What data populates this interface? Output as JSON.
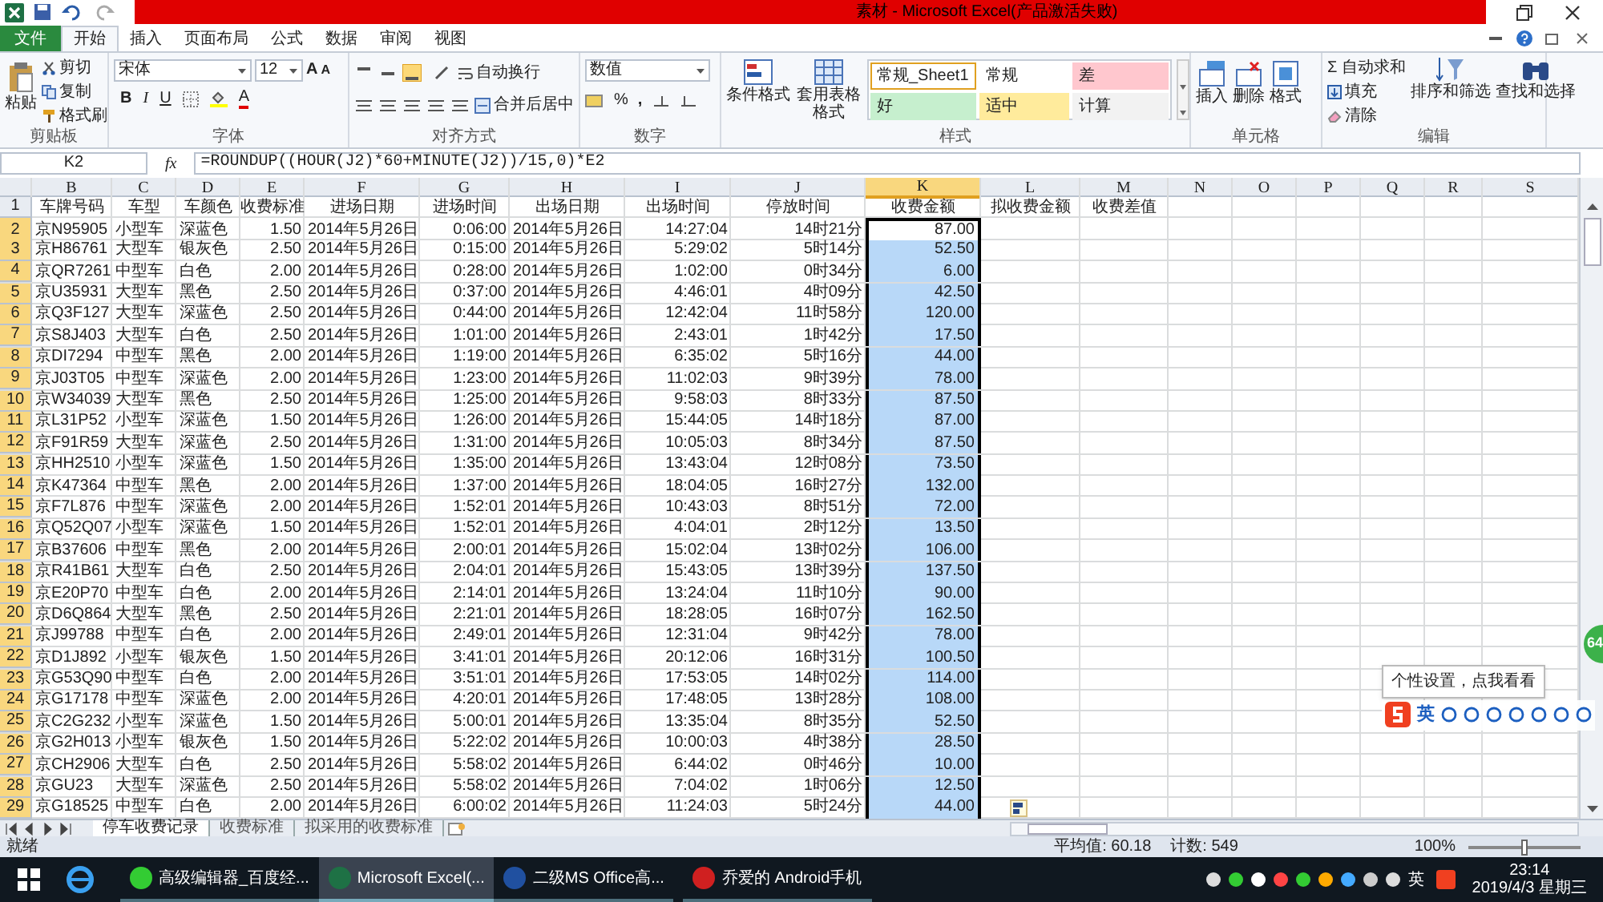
{
  "window": {
    "title": "素材 - Microsoft Excel(产品激活失败)"
  },
  "tabs": [
    {
      "label": "文件",
      "kind": "file",
      "selected": false
    },
    {
      "label": "开始",
      "kind": "tab",
      "selected": true
    },
    {
      "label": "插入",
      "kind": "tab",
      "selected": false
    },
    {
      "label": "页面布局",
      "kind": "tab",
      "selected": false
    },
    {
      "label": "公式",
      "kind": "tab",
      "selected": false
    },
    {
      "label": "数据",
      "kind": "tab",
      "selected": false
    },
    {
      "label": "审阅",
      "kind": "tab",
      "selected": false
    },
    {
      "label": "视图",
      "kind": "tab",
      "selected": false
    }
  ],
  "ribbon": {
    "clipboard": {
      "label": "剪贴板",
      "paste": "粘贴",
      "cut": "剪切",
      "copy": "复制",
      "format_painter": "格式刷"
    },
    "font": {
      "label": "字体",
      "font_name": "宋体",
      "font_size": "12",
      "grow": "A",
      "shrink": "A",
      "bold": "B",
      "italic": "I",
      "underline": "U",
      "color_letter": "A"
    },
    "alignment": {
      "label": "对齐方式",
      "wrap": "自动换行",
      "merge": "合并后居中"
    },
    "number": {
      "label": "数字",
      "format": "数值",
      "percent": "%",
      "comma": ","
    },
    "styles": {
      "label": "样式",
      "conditional": "条件格式",
      "table_format": "套用表格格式",
      "cell_styles": [
        {
          "label": "常规_Sheet1",
          "color": "#ffffff",
          "selected": true
        },
        {
          "label": "常规",
          "color": "#ffffff",
          "selected": false
        },
        {
          "label": "差",
          "color": "#ffc7ce",
          "selected": false
        },
        {
          "label": "好",
          "color": "#c6efce",
          "selected": false
        },
        {
          "label": "适中",
          "color": "#ffeb9c",
          "selected": false
        },
        {
          "label": "计算",
          "color": "#f2f2f2",
          "selected": false
        }
      ]
    },
    "cells": {
      "label": "单元格",
      "insert": "插入",
      "delete": "删除",
      "format": "格式"
    },
    "editing": {
      "label": "编辑",
      "sigma": "Σ",
      "autosum": "自动求和",
      "fill": "填充",
      "clear": "清除",
      "sort": "排序和筛选",
      "find": "查找和选择"
    }
  },
  "formula_bar": {
    "name_box": "K2",
    "fx": "fx",
    "formula": "=ROUNDUP((HOUR(J2)*60+MINUTE(J2))/15,0)*E2"
  },
  "sheet": {
    "columns": [
      {
        "label": "B",
        "selected": false
      },
      {
        "label": "C",
        "selected": false
      },
      {
        "label": "D",
        "selected": false
      },
      {
        "label": "E",
        "selected": false
      },
      {
        "label": "F",
        "selected": false
      },
      {
        "label": "G",
        "selected": false
      },
      {
        "label": "H",
        "selected": false
      },
      {
        "label": "I",
        "selected": false
      },
      {
        "label": "J",
        "selected": false
      },
      {
        "label": "K",
        "selected": true
      },
      {
        "label": "L",
        "selected": false
      },
      {
        "label": "M",
        "selected": false
      },
      {
        "label": "N",
        "selected": false
      },
      {
        "label": "O",
        "selected": false
      },
      {
        "label": "P",
        "selected": false
      },
      {
        "label": "Q",
        "selected": false
      },
      {
        "label": "R",
        "selected": false
      },
      {
        "label": "S",
        "selected": false
      }
    ],
    "header_row": {
      "row_number": "1",
      "cells": [
        "车牌号码",
        "车型",
        "车颜色",
        "收费标准",
        "进场日期",
        "进场时间",
        "出场日期",
        "出场时间",
        "停放时间",
        "收费金额",
        "拟收费金额",
        "收费差值"
      ]
    },
    "rows": [
      {
        "row_number": "2",
        "selected": true,
        "active": true,
        "cells": [
          "京N95905",
          "小型车",
          "深蓝色",
          "1.50",
          "2014年5月26日",
          "0:06:00",
          "2014年5月26日",
          "14:27:04",
          "14时21分",
          "87.00"
        ]
      },
      {
        "row_number": "3",
        "selected": true,
        "active": false,
        "cells": [
          "京H86761",
          "大型车",
          "银灰色",
          "2.50",
          "2014年5月26日",
          "0:15:00",
          "2014年5月26日",
          "5:29:02",
          "5时14分",
          "52.50"
        ]
      },
      {
        "row_number": "4",
        "selected": true,
        "active": false,
        "cells": [
          "京QR7261",
          "中型车",
          "白色",
          "2.00",
          "2014年5月26日",
          "0:28:00",
          "2014年5月26日",
          "1:02:00",
          "0时34分",
          "6.00"
        ]
      },
      {
        "row_number": "5",
        "selected": true,
        "active": false,
        "cells": [
          "京U35931",
          "大型车",
          "黑色",
          "2.50",
          "2014年5月26日",
          "0:37:00",
          "2014年5月26日",
          "4:46:01",
          "4时09分",
          "42.50"
        ]
      },
      {
        "row_number": "6",
        "selected": true,
        "active": false,
        "cells": [
          "京Q3F127",
          "大型车",
          "深蓝色",
          "2.50",
          "2014年5月26日",
          "0:44:00",
          "2014年5月26日",
          "12:42:04",
          "11时58分",
          "120.00"
        ]
      },
      {
        "row_number": "7",
        "selected": true,
        "active": false,
        "cells": [
          "京S8J403",
          "大型车",
          "白色",
          "2.50",
          "2014年5月26日",
          "1:01:00",
          "2014年5月26日",
          "2:43:01",
          "1时42分",
          "17.50"
        ]
      },
      {
        "row_number": "8",
        "selected": true,
        "active": false,
        "cells": [
          "京DI7294",
          "中型车",
          "黑色",
          "2.00",
          "2014年5月26日",
          "1:19:00",
          "2014年5月26日",
          "6:35:02",
          "5时16分",
          "44.00"
        ]
      },
      {
        "row_number": "9",
        "selected": true,
        "active": false,
        "cells": [
          "京J03T05",
          "中型车",
          "深蓝色",
          "2.00",
          "2014年5月26日",
          "1:23:00",
          "2014年5月26日",
          "11:02:03",
          "9时39分",
          "78.00"
        ]
      },
      {
        "row_number": "10",
        "selected": true,
        "active": false,
        "cells": [
          "京W34039",
          "大型车",
          "黑色",
          "2.50",
          "2014年5月26日",
          "1:25:00",
          "2014年5月26日",
          "9:58:03",
          "8时33分",
          "87.50"
        ]
      },
      {
        "row_number": "11",
        "selected": true,
        "active": false,
        "cells": [
          "京L31P52",
          "小型车",
          "深蓝色",
          "1.50",
          "2014年5月26日",
          "1:26:00",
          "2014年5月26日",
          "15:44:05",
          "14时18分",
          "87.00"
        ]
      },
      {
        "row_number": "12",
        "selected": true,
        "active": false,
        "cells": [
          "京F91R59",
          "大型车",
          "深蓝色",
          "2.50",
          "2014年5月26日",
          "1:31:00",
          "2014年5月26日",
          "10:05:03",
          "8时34分",
          "87.50"
        ]
      },
      {
        "row_number": "13",
        "selected": true,
        "active": false,
        "cells": [
          "京HH2510",
          "小型车",
          "深蓝色",
          "1.50",
          "2014年5月26日",
          "1:35:00",
          "2014年5月26日",
          "13:43:04",
          "12时08分",
          "73.50"
        ]
      },
      {
        "row_number": "14",
        "selected": true,
        "active": false,
        "cells": [
          "京K47364",
          "中型车",
          "黑色",
          "2.00",
          "2014年5月26日",
          "1:37:00",
          "2014年5月26日",
          "18:04:05",
          "16时27分",
          "132.00"
        ]
      },
      {
        "row_number": "15",
        "selected": true,
        "active": false,
        "cells": [
          "京F7L876",
          "中型车",
          "深蓝色",
          "2.00",
          "2014年5月26日",
          "1:52:01",
          "2014年5月26日",
          "10:43:03",
          "8时51分",
          "72.00"
        ]
      },
      {
        "row_number": "16",
        "selected": true,
        "active": false,
        "cells": [
          "京Q52Q07",
          "小型车",
          "深蓝色",
          "1.50",
          "2014年5月26日",
          "1:52:01",
          "2014年5月26日",
          "4:04:01",
          "2时12分",
          "13.50"
        ]
      },
      {
        "row_number": "17",
        "selected": true,
        "active": false,
        "cells": [
          "京B37606",
          "中型车",
          "黑色",
          "2.00",
          "2014年5月26日",
          "2:00:01",
          "2014年5月26日",
          "15:02:04",
          "13时02分",
          "106.00"
        ]
      },
      {
        "row_number": "18",
        "selected": true,
        "active": false,
        "cells": [
          "京R41B61",
          "大型车",
          "白色",
          "2.50",
          "2014年5月26日",
          "2:04:01",
          "2014年5月26日",
          "15:43:05",
          "13时39分",
          "137.50"
        ]
      },
      {
        "row_number": "19",
        "selected": true,
        "active": false,
        "cells": [
          "京E20P70",
          "中型车",
          "白色",
          "2.00",
          "2014年5月26日",
          "2:14:01",
          "2014年5月26日",
          "13:24:04",
          "11时10分",
          "90.00"
        ]
      },
      {
        "row_number": "20",
        "selected": true,
        "active": false,
        "cells": [
          "京D6Q864",
          "大型车",
          "黑色",
          "2.50",
          "2014年5月26日",
          "2:21:01",
          "2014年5月26日",
          "18:28:05",
          "16时07分",
          "162.50"
        ]
      },
      {
        "row_number": "21",
        "selected": true,
        "active": false,
        "cells": [
          "京J99788",
          "中型车",
          "白色",
          "2.00",
          "2014年5月26日",
          "2:49:01",
          "2014年5月26日",
          "12:31:04",
          "9时42分",
          "78.00"
        ]
      },
      {
        "row_number": "22",
        "selected": true,
        "active": false,
        "cells": [
          "京D1J892",
          "小型车",
          "银灰色",
          "1.50",
          "2014年5月26日",
          "3:41:01",
          "2014年5月26日",
          "20:12:06",
          "16时31分",
          "100.50"
        ]
      },
      {
        "row_number": "23",
        "selected": true,
        "active": false,
        "cells": [
          "京G53Q90",
          "中型车",
          "白色",
          "2.00",
          "2014年5月26日",
          "3:51:01",
          "2014年5月26日",
          "17:53:05",
          "14时02分",
          "114.00"
        ]
      },
      {
        "row_number": "24",
        "selected": true,
        "active": false,
        "cells": [
          "京G17178",
          "中型车",
          "深蓝色",
          "2.00",
          "2014年5月26日",
          "4:20:01",
          "2014年5月26日",
          "17:48:05",
          "13时28分",
          "108.00"
        ]
      },
      {
        "row_number": "25",
        "selected": true,
        "active": false,
        "cells": [
          "京C2G232",
          "小型车",
          "深蓝色",
          "1.50",
          "2014年5月26日",
          "5:00:01",
          "2014年5月26日",
          "13:35:04",
          "8时35分",
          "52.50"
        ]
      },
      {
        "row_number": "26",
        "selected": true,
        "active": false,
        "cells": [
          "京G2H013",
          "小型车",
          "银灰色",
          "1.50",
          "2014年5月26日",
          "5:22:02",
          "2014年5月26日",
          "10:00:03",
          "4时38分",
          "28.50"
        ]
      },
      {
        "row_number": "27",
        "selected": true,
        "active": false,
        "cells": [
          "京CH2906",
          "大型车",
          "白色",
          "2.50",
          "2014年5月26日",
          "5:58:02",
          "2014年5月26日",
          "6:44:02",
          "0时46分",
          "10.00"
        ]
      },
      {
        "row_number": "28",
        "selected": true,
        "active": false,
        "cells": [
          "京GU23",
          "大型车",
          "深蓝色",
          "2.50",
          "2014年5月26日",
          "5:58:02",
          "2014年5月26日",
          "7:04:02",
          "1时06分",
          "12.50"
        ]
      },
      {
        "row_number": "29",
        "selected": true,
        "active": false,
        "cells": [
          "京G18525",
          "中型车",
          "白色",
          "2.00",
          "2014年5月26日",
          "6:00:02",
          "2014年5月26日",
          "11:24:03",
          "5时24分",
          "44.00"
        ]
      }
    ]
  },
  "sheet_tabs": [
    {
      "label": "停车收费记录",
      "selected": true
    },
    {
      "label": "收费标准",
      "selected": false
    },
    {
      "label": "拟采用的收费标准",
      "selected": false
    }
  ],
  "status_bar": {
    "state": "就绪",
    "average": "平均值: 60.18",
    "count": "计数: 549",
    "zoom": "100%",
    "zoom_slider": {
      "level": 0.5
    }
  },
  "ime": {
    "tooltip": "个性设置，点我看看",
    "mode": "英",
    "badge": "64"
  },
  "taskbar": {
    "apps": [
      {
        "label": "高级编辑器_百度经...",
        "selected": false
      },
      {
        "label": "Microsoft Excel(...",
        "selected": true
      },
      {
        "label": "二级MS Office高...",
        "selected": false
      },
      {
        "label": "乔爱的 Android手机",
        "selected": false
      }
    ],
    "ime": "英",
    "time": "23:14",
    "date": "2019/4/3 星期三"
  }
}
